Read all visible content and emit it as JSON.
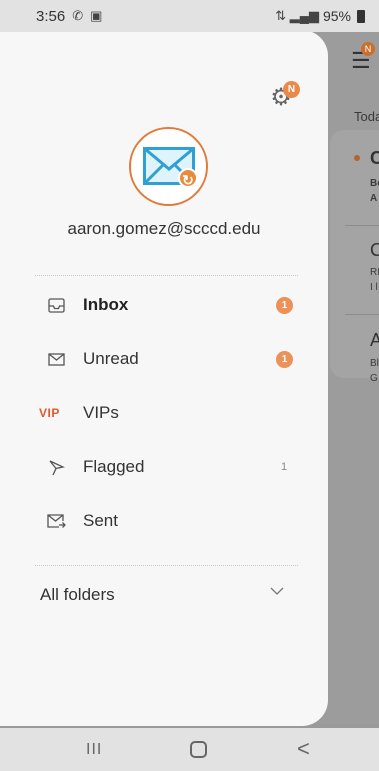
{
  "status_bar": {
    "time": "3:56",
    "battery": "95%"
  },
  "background": {
    "section_label": "Toda",
    "items": [
      {
        "title": "C",
        "line1": "Bo",
        "line2": "A"
      },
      {
        "title": "C",
        "line1": "RI",
        "line2": "I l"
      },
      {
        "title": "A",
        "line1": "Bl",
        "line2": "G"
      }
    ],
    "badge": "N"
  },
  "drawer": {
    "settings_badge": "N",
    "account_email": "aaron.gomez@scccd.edu",
    "nav": [
      {
        "label": "Inbox",
        "icon": "inbox-icon",
        "badge": "1"
      },
      {
        "label": "Unread",
        "icon": "envelope-icon",
        "badge": "1"
      },
      {
        "label": "VIPs",
        "icon": "vip-icon",
        "icon_text": "VIP"
      },
      {
        "label": "Flagged",
        "icon": "flag-icon",
        "count": "1"
      },
      {
        "label": "Sent",
        "icon": "sent-icon"
      }
    ],
    "folders_label": "All folders"
  },
  "nav_bar": {
    "recents": "III",
    "back": "<"
  },
  "colors": {
    "accent": "#e98a4a",
    "vip": "#e4582c",
    "drawer": "#f7f7f7"
  }
}
